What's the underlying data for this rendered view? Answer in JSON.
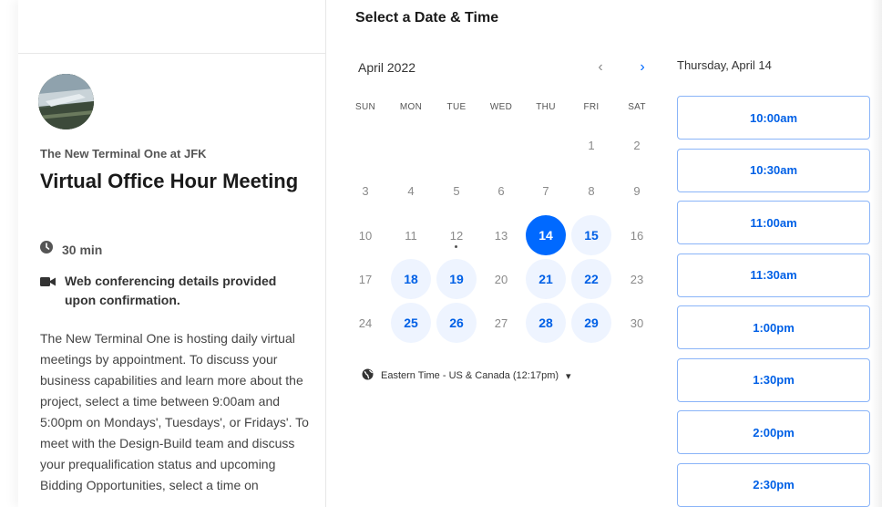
{
  "left": {
    "org_name": "The New Terminal One at JFK",
    "event_title": "Virtual Office Hour Meeting",
    "duration": "30 min",
    "conferencing": "Web conferencing details provided upon confirmation.",
    "description": "The New Terminal One is hosting daily virtual meetings by appointment. To discuss your business capabilities and learn more about the project, select a time between 9:00am and 5:00pm on Mondays', Tuesdays', or Fridays'. To meet with the Design-Build team and discuss your prequalification status and upcoming Bidding Opportunities, select a time on"
  },
  "calendar": {
    "section_title": "Select a Date & Time",
    "month_label": "April 2022",
    "prev_icon": "‹",
    "next_icon": "›",
    "weekdays": [
      "SUN",
      "MON",
      "TUE",
      "WED",
      "THU",
      "FRI",
      "SAT"
    ],
    "weeks": [
      [
        "",
        "",
        "",
        "",
        "",
        "1",
        "2"
      ],
      [
        "3",
        "4",
        "5",
        "6",
        "7",
        "8",
        "9"
      ],
      [
        "10",
        "11",
        "12",
        "13",
        "14",
        "15",
        "16"
      ],
      [
        "17",
        "18",
        "19",
        "20",
        "21",
        "22",
        "23"
      ],
      [
        "24",
        "25",
        "26",
        "27",
        "28",
        "29",
        "30"
      ]
    ],
    "available_days": [
      "15",
      "18",
      "19",
      "21",
      "22",
      "25",
      "26",
      "28",
      "29"
    ],
    "selected_day": "14",
    "today_day": "12",
    "timezone": "Eastern Time - US & Canada (12:17pm)",
    "timezone_caret": "▾"
  },
  "times": {
    "selected_day_label": "Thursday, April 14",
    "slots": [
      "10:00am",
      "10:30am",
      "11:00am",
      "11:30am",
      "1:00pm",
      "1:30pm",
      "2:00pm",
      "2:30pm"
    ]
  },
  "colors": {
    "accent": "#0069ff",
    "available_bg": "#eef4ff",
    "slot_border": "#8ab4f8"
  }
}
